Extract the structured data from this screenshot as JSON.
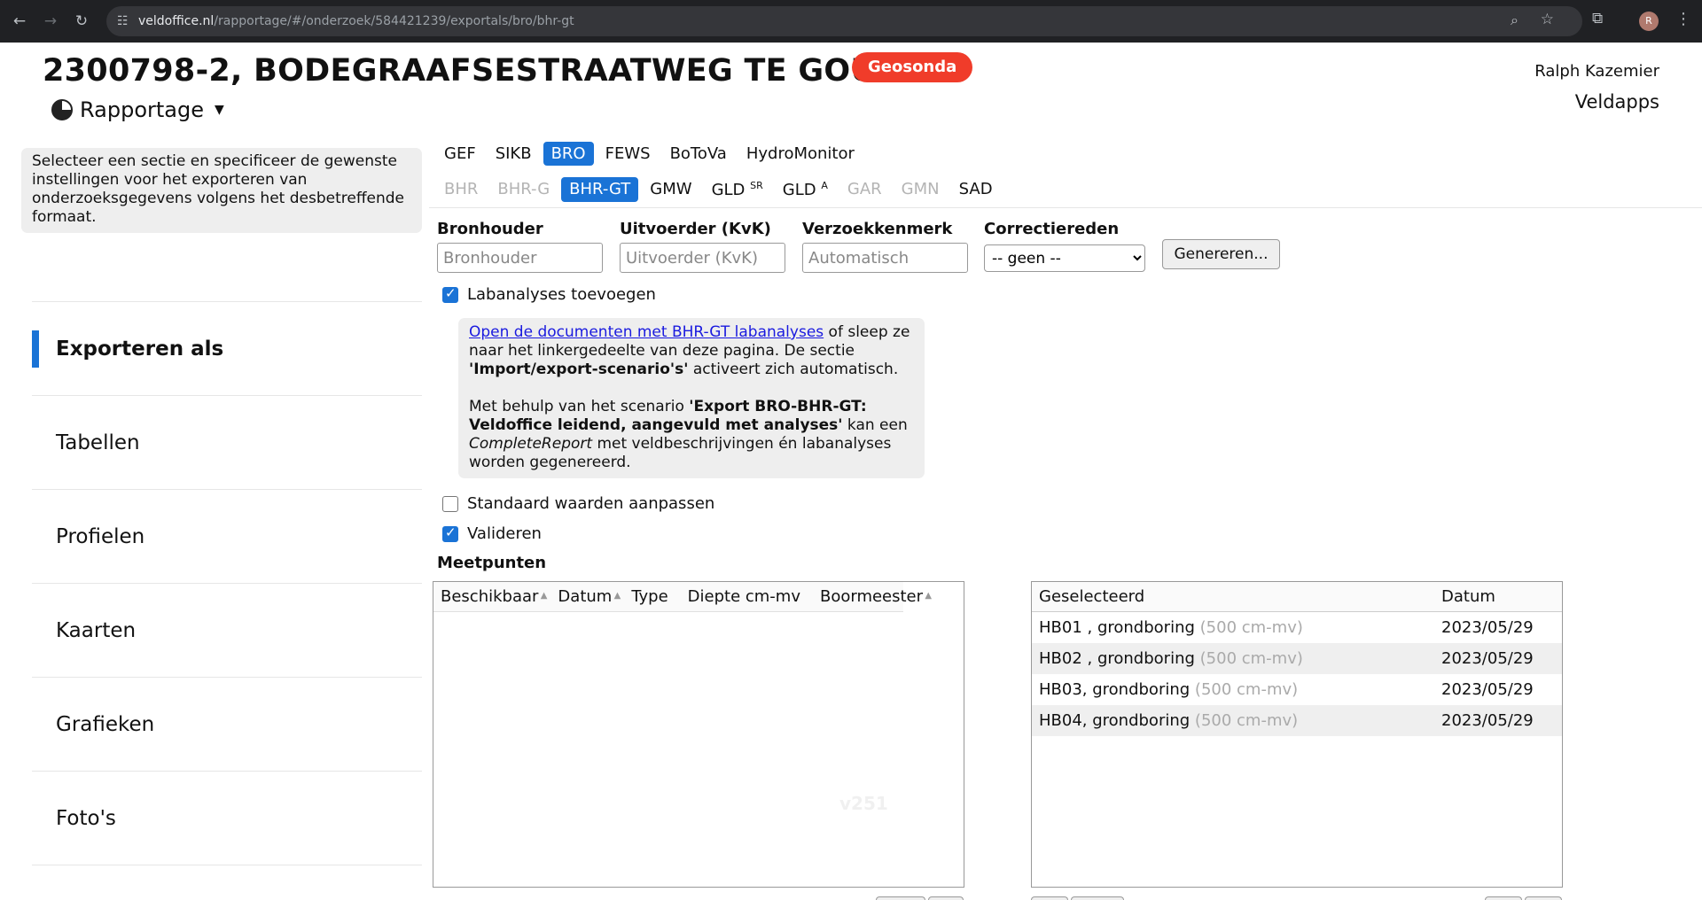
{
  "browser": {
    "url_host": "veldoffice.nl",
    "url_path": "/rapportage/#/onderzoek/584421239/exportals/bro/bhr-gt",
    "profile_initial": "R"
  },
  "header": {
    "title": "2300798-2, BODEGRAAFSESTRAATWEG TE GOUDA",
    "badge": "Geosonda",
    "badge_color": "#f03c2a",
    "user_name": "Ralph Kazemier",
    "app_name": "Veldapps",
    "mode_label": "Rapportage"
  },
  "sidebar": {
    "info": "Selecteer een sectie en specificeer de gewenste instellingen voor het exporteren van onderzoeksgegevens volgens het desbetreffende formaat.",
    "items": [
      {
        "label": "Exporteren als",
        "active": true
      },
      {
        "label": "Tabellen"
      },
      {
        "label": "Profielen"
      },
      {
        "label": "Kaarten"
      },
      {
        "label": "Grafieken"
      },
      {
        "label": "Foto's"
      }
    ]
  },
  "tabs_primary": [
    "GEF",
    "SIKB",
    "BRO",
    "FEWS",
    "BoToVa",
    "HydroMonitor"
  ],
  "tabs_primary_selected": "BRO",
  "tabs_secondary": {
    "bhr": "BHR",
    "bhr_g": "BHR-G",
    "bhr_gt": "BHR-GT",
    "gmw": "GMW",
    "gld_sr": "GLD",
    "gld_sr_sup": "SR",
    "gld_a": "GLD",
    "gld_a_sup": "A",
    "gar": "GAR",
    "gmn": "GMN",
    "sad": "SAD"
  },
  "form": {
    "bronhouder_label": "Bronhouder",
    "bronhouder_placeholder": "Bronhouder",
    "uitvoerder_label": "Uitvoerder (KvK)",
    "uitvoerder_placeholder": "Uitvoerder (KvK)",
    "verzoekkenmerk_label": "Verzoekkenmerk",
    "verzoekkenmerk_placeholder": "Automatisch",
    "correctiereden_label": "Correctiereden",
    "correctiereden_value": "-- geen --",
    "generate_label": "Genereren..."
  },
  "options": {
    "labanalyses": "Labanalyses toevoegen",
    "standaard": "Standaard waarden aanpassen",
    "valideren": "Valideren"
  },
  "note": {
    "link": "Open de documenten met BHR-GT labanalyses",
    "text1": " of sleep ze naar het linkergedeelte van deze pagina. De sectie ",
    "bold1": "'Import/export-scenario's'",
    "text2": " activeert zich automatisch.",
    "text3": "Met behulp van het scenario ",
    "bold2": "'Export BRO-BHR-GT: Veldoffice leidend, aangevuld met analyses'",
    "text4": " kan een ",
    "italic1": "CompleteReport",
    "text5": " met veldbeschrijvingen én labanalyses worden gegenereerd."
  },
  "meetpunten": {
    "label": "Meetpunten",
    "available_columns": [
      "Beschikbaar",
      "Datum",
      "Type",
      "Diepte cm-mv",
      "Boormeester"
    ],
    "version": "v251",
    "selected_header": "Geselecteerd",
    "date_header": "Datum",
    "selected_rows": [
      {
        "name": "HB01 , grondboring",
        "depth": "(500 cm-mv)",
        "date": "2023/05/29"
      },
      {
        "name": "HB02 , grondboring",
        "depth": "(500 cm-mv)",
        "date": "2023/05/29"
      },
      {
        "name": "HB03, grondboring",
        "depth": "(500 cm-mv)",
        "date": "2023/05/29"
      },
      {
        "name": "HB04, grondboring",
        "depth": "(500 cm-mv)",
        "date": "2023/05/29"
      }
    ]
  },
  "icons": {
    "back": "arrow-left-icon",
    "forward": "arrow-right-icon",
    "reload": "reload-icon",
    "site_settings": "tune-icon",
    "zoom": "zoom-icon",
    "bookmark": "star-icon",
    "extensions": "puzzle-icon",
    "menu": "kebab-menu-icon",
    "mode": "pie-chart-icon",
    "mode_caret": "caret-down-icon"
  }
}
